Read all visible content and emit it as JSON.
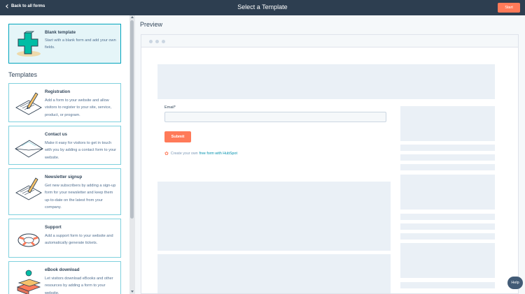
{
  "header": {
    "back_label": "Back to all forms",
    "title": "Select a Template",
    "start_label": "Start"
  },
  "sidebar": {
    "blank": {
      "title": "Blank template",
      "description": "Start with a blank form and add your own fields."
    },
    "templates_heading": "Templates",
    "templates": [
      {
        "title": "Registration",
        "description": "Add a form to your website and allow visitors to register to your site, service, product, or program.",
        "icon": "clipboard-pen-icon"
      },
      {
        "title": "Contact us",
        "description": "Make it easy for visitors to get in touch with you by adding a contact form to your website.",
        "icon": "envelope-icon"
      },
      {
        "title": "Newsletter signup",
        "description": "Get new subscribers by adding a sign-up form for your newsletter and keep them up-to-date on the latest from your company.",
        "icon": "newsletter-pen-icon"
      },
      {
        "title": "Support",
        "description": "Add a support form to your website and automatically generate tickets.",
        "icon": "lifebuoy-icon"
      },
      {
        "title": "eBook download",
        "description": "Let visitors download eBooks and other resources by adding a form to your website.",
        "icon": "books-icon"
      }
    ]
  },
  "preview": {
    "label": "Preview",
    "form": {
      "email_label": "Email*",
      "email_value": "",
      "submit_label": "Submit",
      "credit_prefix": "Create your own",
      "credit_link": "free form with HubSpot"
    }
  },
  "help_label": "Help",
  "colors": {
    "topbar": "#2d3e50",
    "accent": "#ff7a59",
    "selected_border": "#00a4bd",
    "card_border": "#7fd1de",
    "placeholder": "#eaf0f6"
  }
}
